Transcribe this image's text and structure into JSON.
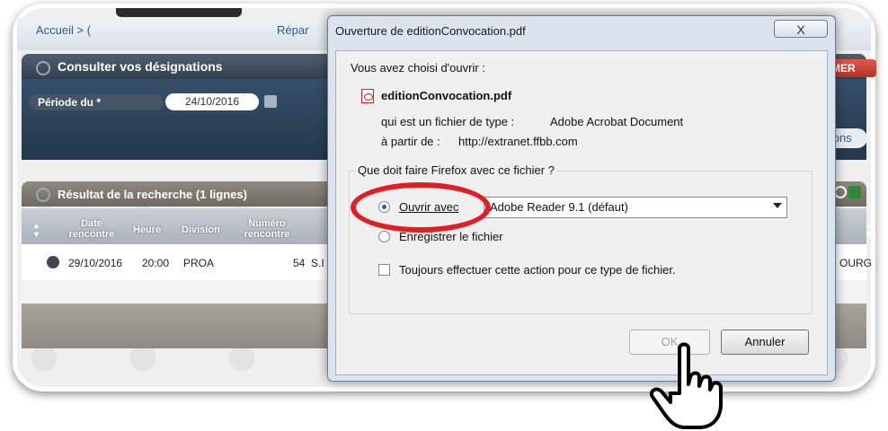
{
  "background": {
    "breadcrumb_left": "Accueil > (",
    "breadcrumb_right": "Répar",
    "panel1_title": "Consulter vos désignations",
    "periode_label": "Période du *",
    "periode_value": "24/10/2016",
    "red_button": "MER",
    "right_button": "ations",
    "panel2_title": "Résultat de la recherche (1 lignes)",
    "table": {
      "headers": [
        "Date rencontre",
        "Heure",
        "Division",
        "Numéro rencontre"
      ],
      "row": {
        "date": "29/10/2016",
        "heure": "20:00",
        "division": "PROA",
        "numero": "54",
        "s": "S.I",
        "right": "OURG"
      }
    },
    "colors": {
      "panel_dark": "#34414e",
      "accent_red": "#e01e25"
    }
  },
  "dialog": {
    "title": "Ouverture de editionConvocation.pdf",
    "close": "X",
    "intro": "Vous avez choisi d'ouvrir :",
    "filename": "editionConvocation.pdf",
    "type_line_label": "qui est un fichier de type :",
    "type_line_value": "Adobe Acrobat Document",
    "from_line_label": "à partir de :",
    "from_line_value": "http://extranet.ffbb.com",
    "question": "Que doit faire Firefox avec ce fichier ?",
    "open_with_label": "Ouvrir avec",
    "open_with_value": "Adobe Reader 9.1 (défaut)",
    "save_label": "Enregistrer le fichier",
    "always_label": "Toujours effectuer cette action pour ce type de fichier.",
    "ok_label": "OK",
    "cancel_label": "Annuler"
  }
}
